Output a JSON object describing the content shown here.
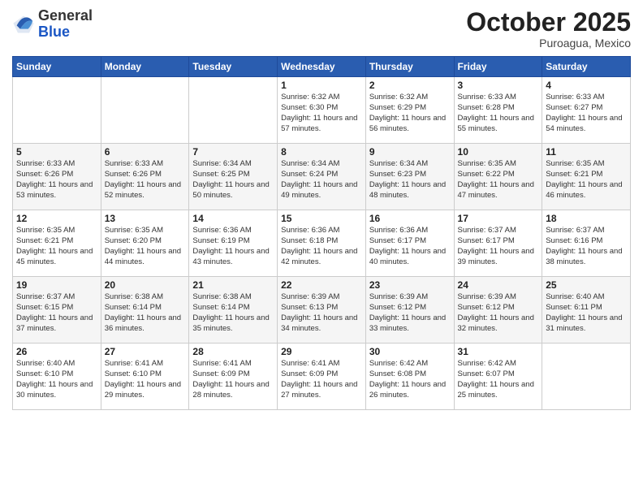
{
  "header": {
    "logo_general": "General",
    "logo_blue": "Blue",
    "month": "October 2025",
    "location": "Puroagua, Mexico"
  },
  "days_of_week": [
    "Sunday",
    "Monday",
    "Tuesday",
    "Wednesday",
    "Thursday",
    "Friday",
    "Saturday"
  ],
  "weeks": [
    [
      {
        "day": "",
        "info": ""
      },
      {
        "day": "",
        "info": ""
      },
      {
        "day": "",
        "info": ""
      },
      {
        "day": "1",
        "info": "Sunrise: 6:32 AM\nSunset: 6:30 PM\nDaylight: 11 hours and 57 minutes."
      },
      {
        "day": "2",
        "info": "Sunrise: 6:32 AM\nSunset: 6:29 PM\nDaylight: 11 hours and 56 minutes."
      },
      {
        "day": "3",
        "info": "Sunrise: 6:33 AM\nSunset: 6:28 PM\nDaylight: 11 hours and 55 minutes."
      },
      {
        "day": "4",
        "info": "Sunrise: 6:33 AM\nSunset: 6:27 PM\nDaylight: 11 hours and 54 minutes."
      }
    ],
    [
      {
        "day": "5",
        "info": "Sunrise: 6:33 AM\nSunset: 6:26 PM\nDaylight: 11 hours and 53 minutes."
      },
      {
        "day": "6",
        "info": "Sunrise: 6:33 AM\nSunset: 6:26 PM\nDaylight: 11 hours and 52 minutes."
      },
      {
        "day": "7",
        "info": "Sunrise: 6:34 AM\nSunset: 6:25 PM\nDaylight: 11 hours and 50 minutes."
      },
      {
        "day": "8",
        "info": "Sunrise: 6:34 AM\nSunset: 6:24 PM\nDaylight: 11 hours and 49 minutes."
      },
      {
        "day": "9",
        "info": "Sunrise: 6:34 AM\nSunset: 6:23 PM\nDaylight: 11 hours and 48 minutes."
      },
      {
        "day": "10",
        "info": "Sunrise: 6:35 AM\nSunset: 6:22 PM\nDaylight: 11 hours and 47 minutes."
      },
      {
        "day": "11",
        "info": "Sunrise: 6:35 AM\nSunset: 6:21 PM\nDaylight: 11 hours and 46 minutes."
      }
    ],
    [
      {
        "day": "12",
        "info": "Sunrise: 6:35 AM\nSunset: 6:21 PM\nDaylight: 11 hours and 45 minutes."
      },
      {
        "day": "13",
        "info": "Sunrise: 6:35 AM\nSunset: 6:20 PM\nDaylight: 11 hours and 44 minutes."
      },
      {
        "day": "14",
        "info": "Sunrise: 6:36 AM\nSunset: 6:19 PM\nDaylight: 11 hours and 43 minutes."
      },
      {
        "day": "15",
        "info": "Sunrise: 6:36 AM\nSunset: 6:18 PM\nDaylight: 11 hours and 42 minutes."
      },
      {
        "day": "16",
        "info": "Sunrise: 6:36 AM\nSunset: 6:17 PM\nDaylight: 11 hours and 40 minutes."
      },
      {
        "day": "17",
        "info": "Sunrise: 6:37 AM\nSunset: 6:17 PM\nDaylight: 11 hours and 39 minutes."
      },
      {
        "day": "18",
        "info": "Sunrise: 6:37 AM\nSunset: 6:16 PM\nDaylight: 11 hours and 38 minutes."
      }
    ],
    [
      {
        "day": "19",
        "info": "Sunrise: 6:37 AM\nSunset: 6:15 PM\nDaylight: 11 hours and 37 minutes."
      },
      {
        "day": "20",
        "info": "Sunrise: 6:38 AM\nSunset: 6:14 PM\nDaylight: 11 hours and 36 minutes."
      },
      {
        "day": "21",
        "info": "Sunrise: 6:38 AM\nSunset: 6:14 PM\nDaylight: 11 hours and 35 minutes."
      },
      {
        "day": "22",
        "info": "Sunrise: 6:39 AM\nSunset: 6:13 PM\nDaylight: 11 hours and 34 minutes."
      },
      {
        "day": "23",
        "info": "Sunrise: 6:39 AM\nSunset: 6:12 PM\nDaylight: 11 hours and 33 minutes."
      },
      {
        "day": "24",
        "info": "Sunrise: 6:39 AM\nSunset: 6:12 PM\nDaylight: 11 hours and 32 minutes."
      },
      {
        "day": "25",
        "info": "Sunrise: 6:40 AM\nSunset: 6:11 PM\nDaylight: 11 hours and 31 minutes."
      }
    ],
    [
      {
        "day": "26",
        "info": "Sunrise: 6:40 AM\nSunset: 6:10 PM\nDaylight: 11 hours and 30 minutes."
      },
      {
        "day": "27",
        "info": "Sunrise: 6:41 AM\nSunset: 6:10 PM\nDaylight: 11 hours and 29 minutes."
      },
      {
        "day": "28",
        "info": "Sunrise: 6:41 AM\nSunset: 6:09 PM\nDaylight: 11 hours and 28 minutes."
      },
      {
        "day": "29",
        "info": "Sunrise: 6:41 AM\nSunset: 6:09 PM\nDaylight: 11 hours and 27 minutes."
      },
      {
        "day": "30",
        "info": "Sunrise: 6:42 AM\nSunset: 6:08 PM\nDaylight: 11 hours and 26 minutes."
      },
      {
        "day": "31",
        "info": "Sunrise: 6:42 AM\nSunset: 6:07 PM\nDaylight: 11 hours and 25 minutes."
      },
      {
        "day": "",
        "info": ""
      }
    ]
  ]
}
